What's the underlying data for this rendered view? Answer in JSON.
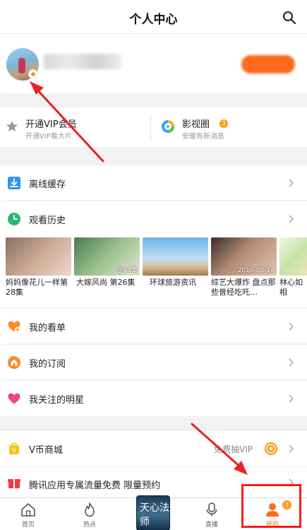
{
  "header": {
    "title": "个人中心",
    "search_icon": "search-icon"
  },
  "vip": {
    "title": "开通VIP会员",
    "subtitle": "开通VIP看大片",
    "icon": "star-icon"
  },
  "circle": {
    "title": "影视圈",
    "badge": "3",
    "subtitle": "安暖有新消息",
    "icon": "play-circle-icon"
  },
  "offline": {
    "label": "离线缓存",
    "icon": "download-icon"
  },
  "history": {
    "label": "观看历史",
    "icon": "clock-icon",
    "items": [
      {
        "caption": "妈妈像花儿一样第28集",
        "stamp": ""
      },
      {
        "caption": "大嫁风尚 第26集",
        "stamp": "全44集"
      },
      {
        "caption": "环球旅游资讯",
        "stamp": ""
      },
      {
        "caption": "综艺大爆炸 盘点那些曾经吃吒…",
        "stamp": "2016-08-14"
      },
      {
        "caption": "林心如相",
        "stamp": ""
      }
    ]
  },
  "watchlist": {
    "label": "我的看单",
    "icon": "heart-plus-icon"
  },
  "subscriptions": {
    "label": "我的订阅",
    "icon": "house-icon"
  },
  "stars": {
    "label": "我关注的明星",
    "icon": "heart-icon"
  },
  "vcoin": {
    "label": "V币商城",
    "right_text": "免费抽VIP",
    "icon": "vcoin-bag-icon"
  },
  "promo": {
    "label": "腾讯应用专属流量免费 限量预约",
    "icon": "gift-icon"
  },
  "nav": {
    "home": "首页",
    "hot": "热点",
    "live": "直播",
    "mine": "我的",
    "mine_badge": "3",
    "center_cover_text": "天心法师"
  },
  "colors": {
    "accent": "#ff6a1c",
    "annotation": "#ff1a1a"
  }
}
